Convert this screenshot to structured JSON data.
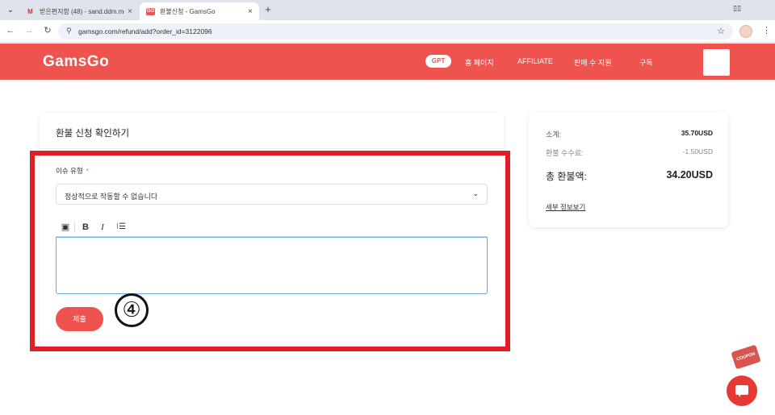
{
  "browser": {
    "tabs": [
      {
        "favicon": "gmail-icon",
        "favicon_text": "M",
        "title": "받은편지함 (48) - sand.ddm.mg..."
      },
      {
        "favicon": "gamsgo-icon",
        "favicon_text": "GG",
        "title": "환불신청 - GamsGo"
      }
    ],
    "url": "gamsgo.com/refund/add?order_id=3122096"
  },
  "site_header": {
    "logo": "GamsGo",
    "nav": {
      "gpt": "GPT",
      "home": "홈 페이지",
      "affiliate": "AFFILIATE",
      "reseller": "판매 수 지원",
      "subscribe": "구독"
    },
    "brand_color": "#ef5350"
  },
  "refund_form": {
    "title": "환불 신청 확인하기",
    "issue_label": "이슈 유형",
    "required_mark": "*",
    "selected_issue": "정상적으로 작동할 수 없습니다",
    "editor_toolbar": {
      "image": "▣",
      "bold": "B",
      "italic": "I",
      "list": "⁝☰"
    },
    "description_value": "",
    "submit_label": "제출"
  },
  "annotation": {
    "step_number": "④",
    "highlight_color": "#e01e26"
  },
  "summary": {
    "total_label": "소계:",
    "total_value": "35.70USD",
    "fee_label": "환불 수수료:",
    "fee_value": "-1.50USD",
    "refund_label": "총 환불액:",
    "refund_value": "34.20USD",
    "details_link": "세부 정보보기"
  },
  "widgets": {
    "coupon": "COUPON",
    "chat_icon": "chat-icon"
  }
}
